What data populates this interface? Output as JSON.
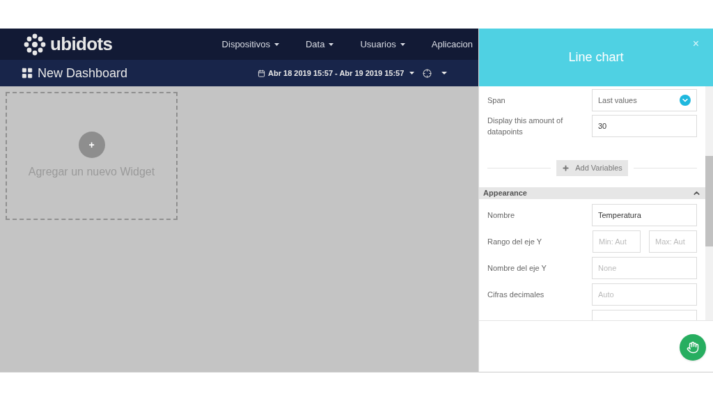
{
  "brand": {
    "name": "ubidots"
  },
  "nav": [
    {
      "label": "Dispositivos",
      "caret": true
    },
    {
      "label": "Data",
      "caret": true
    },
    {
      "label": "Usuarios",
      "caret": true
    },
    {
      "label": "Aplicacion",
      "caret": false
    }
  ],
  "dashboard": {
    "title": "New Dashboard",
    "date_range": "Abr 18 2019 15:57 - Abr 19 2019 15:57"
  },
  "widget_placeholder": {
    "plus": "+",
    "label": "Agregar un nuevo Widget"
  },
  "panel": {
    "title": "Line chart",
    "close": "×",
    "rows": [
      {
        "kind": "select",
        "label": "Span",
        "value": "Last values"
      },
      {
        "kind": "input",
        "label": "Display this amount of datapoints",
        "value": "30"
      },
      {
        "kind": "button",
        "label": "Add Variables"
      },
      {
        "kind": "section",
        "label": "Appearance",
        "expanded": true
      },
      {
        "kind": "input",
        "label": "Nombre",
        "value": "Temperatura"
      },
      {
        "kind": "range",
        "label": "Rango del eje Y",
        "placeholders": [
          "Min: Aut",
          "Max: Aut"
        ]
      },
      {
        "kind": "input",
        "label": "Nombre del eje Y",
        "placeholder": "None"
      },
      {
        "kind": "input",
        "label": "Cifras decimales",
        "placeholder": "Auto"
      },
      {
        "kind": "blank"
      }
    ]
  }
}
